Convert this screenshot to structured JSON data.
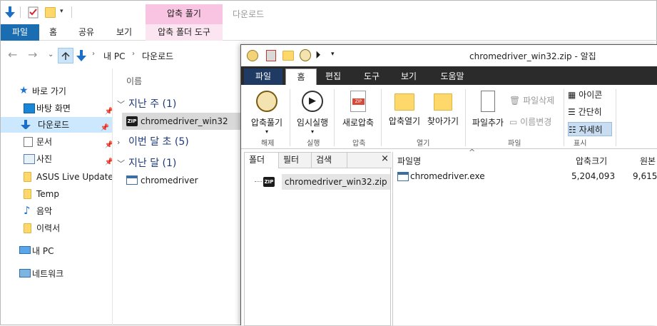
{
  "explorer": {
    "window_title": "다운로드",
    "context_tab": "압축 풀기",
    "tabs": [
      "파일",
      "홈",
      "공유",
      "보기",
      "압축 폴더 도구"
    ],
    "address": {
      "root": "내 PC",
      "folder": "다운로드"
    },
    "nav": [
      {
        "label": "바로 가기",
        "icon": "star-icon"
      },
      {
        "label": "바탕 화면",
        "icon": "desktop-icon",
        "pinned": true
      },
      {
        "label": "다운로드",
        "icon": "download-arrow-icon",
        "pinned": true,
        "selected": true
      },
      {
        "label": "문서",
        "icon": "document-icon",
        "pinned": true
      },
      {
        "label": "사진",
        "icon": "picture-icon",
        "pinned": true
      },
      {
        "label": "ASUS Live Update",
        "icon": "folder-icon"
      },
      {
        "label": "Temp",
        "icon": "folder-icon"
      },
      {
        "label": "음악",
        "icon": "music-icon"
      },
      {
        "label": "이력서",
        "icon": "folder-icon"
      },
      {
        "label": "내 PC",
        "icon": "pc-icon"
      },
      {
        "label": "네트워크",
        "icon": "network-icon"
      }
    ],
    "column_header": "이름",
    "groups": [
      {
        "label": "지난 주 (1)",
        "files": [
          "chromedriver_win32"
        ]
      },
      {
        "label": "이번 달 초 (5)",
        "files": []
      },
      {
        "label": "지난 달 (1)",
        "files": [
          "chromedriver"
        ]
      }
    ]
  },
  "alzip": {
    "title": "chromedriver_win32.zip - 알집",
    "tabs": [
      "파일",
      "홈",
      "편집",
      "도구",
      "보기",
      "도움말"
    ],
    "ribbon": {
      "extract": "압축풀기",
      "extract_group": "해제",
      "temp_run": "임시실행",
      "temp_run_group": "실행",
      "new_zip": "새로압축",
      "new_zip_group": "압축",
      "zip_icon_text": "ZIP",
      "open_archive": "압축열기",
      "find": "찾아가기",
      "open_group": "열기",
      "add_file": "파일추가",
      "delete_file": "파일삭제",
      "rename": "이름변경",
      "file_group": "파일",
      "view_icon": "아이콘",
      "view_simple": "간단히",
      "view_detail": "자세히",
      "view_group": "표시"
    },
    "folder_pane": {
      "tabs": [
        "폴더",
        "필터",
        "검색"
      ],
      "close": "×",
      "tree_item": "chromedriver_win32.zip"
    },
    "list": {
      "headers": [
        "파일명",
        "압축크기",
        "원본"
      ],
      "rows": [
        {
          "name": "chromedriver.exe",
          "compressed": "5,204,093",
          "original": "9,615,"
        }
      ]
    }
  },
  "zip_badge": "ZIP"
}
